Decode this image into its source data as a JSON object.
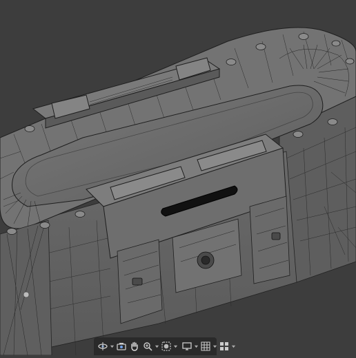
{
  "viewport": {
    "name": "3D Viewport",
    "view_mode": "wireframe",
    "background_color": "#3d3d3d",
    "mesh_fill_color": "#6b6b6b",
    "wire_color": "#1e1e1e"
  },
  "toolbar": {
    "items": [
      {
        "name": "orbit-icon",
        "dropdown": true
      },
      {
        "name": "camera-view-icon",
        "dropdown": false
      },
      {
        "name": "pan-hand-icon",
        "dropdown": false
      },
      {
        "name": "zoom-icon",
        "dropdown": true
      },
      {
        "name": "overlay-sphere-icon",
        "dropdown": true
      },
      {
        "name": "monitor-icon",
        "dropdown": true
      },
      {
        "name": "grid-icon",
        "dropdown": true
      },
      {
        "name": "layout-icon",
        "dropdown": true
      }
    ],
    "accent_color": "#4772b3"
  }
}
